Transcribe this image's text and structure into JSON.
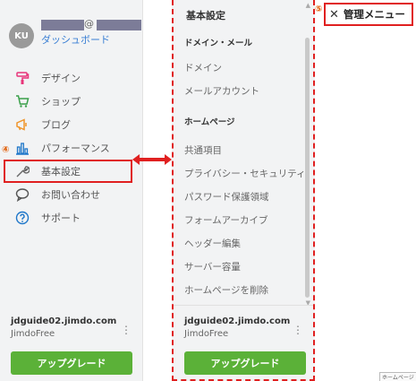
{
  "account": {
    "initials": "KU",
    "email_at": "@",
    "dashboard_link": "ダッシュボード"
  },
  "sidebar": {
    "items": [
      {
        "label": "デザイン",
        "icon": "paint-roller-icon"
      },
      {
        "label": "ショップ",
        "icon": "cart-icon"
      },
      {
        "label": "ブログ",
        "icon": "megaphone-icon"
      },
      {
        "label": "パフォーマンス",
        "icon": "bar-chart-icon"
      },
      {
        "label": "基本設定",
        "icon": "wrench-icon"
      },
      {
        "label": "お問い合わせ",
        "icon": "speech-bubble-icon"
      },
      {
        "label": "サポート",
        "icon": "question-circle-icon"
      }
    ],
    "marker": "④"
  },
  "site": {
    "domain": "jdguide02.jimdo.com",
    "plan": "JimdoFree",
    "menu_icon": "kebab-icon"
  },
  "upgrade_label": "アップグレード",
  "settings_panel": {
    "header": "基本設定",
    "section_domain_mail": "ドメイン・メール",
    "domain_items": [
      "ドメイン",
      "メールアカウント"
    ],
    "section_homepage": "ホームページ",
    "homepage_items": [
      "共通項目",
      "プライバシー・セキュリティ",
      "パスワード保護領域",
      "フォームアーカイブ",
      "ヘッダー編集",
      "サーバー容量",
      "ホームページを削除"
    ]
  },
  "admin_menu": {
    "marker": "⑤",
    "close_label": "管理メニュー"
  },
  "bottom_tab_label": "ホームページ",
  "colors": {
    "accent_red": "#e02020",
    "brand_pink": "#e8357a",
    "brand_green": "#3aa04a",
    "brand_orange": "#f0952a",
    "brand_blue": "#1f77c9",
    "upgrade_green": "#5bb138"
  }
}
